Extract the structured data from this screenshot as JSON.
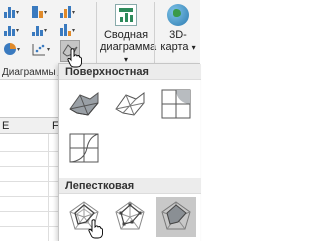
{
  "ribbon": {
    "pivot_chart": {
      "line1": "Сводная",
      "line2": "диаграмма",
      "dropdown": "▾"
    },
    "map3d": {
      "line1": "3D-",
      "line2": "карта",
      "dropdown": "▾"
    },
    "group_label": "Диаграммы",
    "icons": [
      "column-chart-icon",
      "line-chart-icon",
      "pie-chart-icon",
      "hierarchy-chart-icon",
      "waterfall-chart-icon",
      "scatter-chart-icon",
      "combo-chart-icon",
      "surface-chart-icon"
    ]
  },
  "sheet": {
    "columns": [
      "E",
      "F"
    ]
  },
  "gallery": {
    "sections": [
      {
        "title": "Поверхностная",
        "items": [
          "surface-3d",
          "wireframe-surface-3d",
          "contour",
          "wireframe-contour"
        ]
      },
      {
        "title": "Лепестковая",
        "items": [
          "radar",
          "radar-with-markers",
          "filled-radar"
        ]
      }
    ],
    "selected": "filled-radar"
  },
  "colors": {
    "accent": "#217346",
    "surface_green": "#4a7a3a",
    "selected_bg": "#c8c8c8"
  }
}
